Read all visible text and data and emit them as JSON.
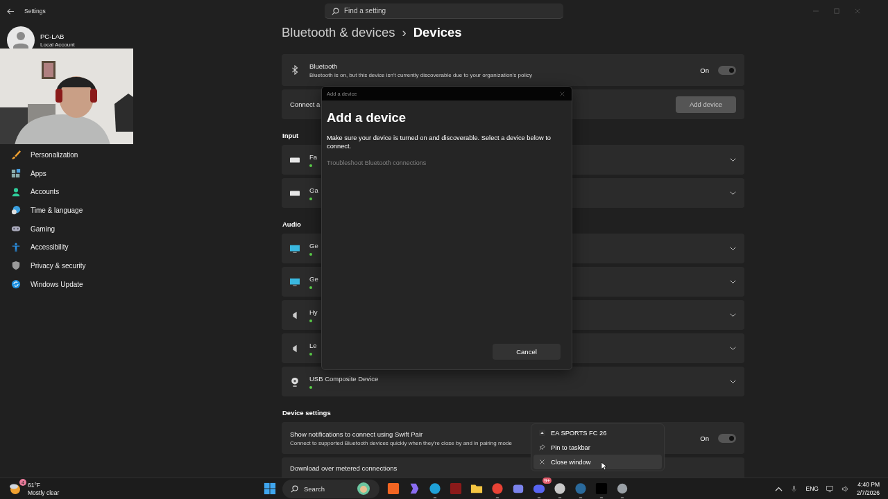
{
  "window": {
    "title": "Settings",
    "search_placeholder": "Find a setting"
  },
  "profile": {
    "name": "PC-LAB",
    "account": "Local Account"
  },
  "sidebar": {
    "items": [
      {
        "label": "Personalization",
        "selected": false
      },
      {
        "label": "Apps",
        "selected": false
      },
      {
        "label": "Accounts",
        "selected": false
      },
      {
        "label": "Time & language",
        "selected": false
      },
      {
        "label": "Gaming",
        "selected": false
      },
      {
        "label": "Accessibility",
        "selected": false
      },
      {
        "label": "Privacy & security",
        "selected": false
      },
      {
        "label": "Windows Update",
        "selected": false
      }
    ]
  },
  "breadcrumb": {
    "parent": "Bluetooth & devices",
    "separator": "›",
    "current": "Devices"
  },
  "bluetooth": {
    "title": "Bluetooth",
    "description": "Bluetooth is on, but this device isn't currently discoverable due to your organization's policy",
    "state_label": "On",
    "on": true
  },
  "connect": {
    "label": "Connect a",
    "button": "Add device"
  },
  "sections": [
    {
      "title": "Input",
      "devices": [
        {
          "name": "Fa",
          "kind": "keyboard",
          "connected": true
        },
        {
          "name": "Ga",
          "kind": "keyboard",
          "connected": true
        }
      ]
    },
    {
      "title": "Audio",
      "devices": [
        {
          "name": "Ge",
          "kind": "monitor",
          "connected": true
        },
        {
          "name": "Ge",
          "kind": "monitor",
          "connected": true
        },
        {
          "name": "Hy",
          "kind": "speaker",
          "connected": true
        },
        {
          "name": "Le",
          "kind": "speaker",
          "connected": true
        },
        {
          "name": "USB Composite Device",
          "kind": "webcam",
          "connected": true
        }
      ]
    }
  ],
  "device_settings": {
    "title": "Device settings",
    "swift_pair": {
      "title": "Show notifications to connect using Swift Pair",
      "description": "Connect to supported Bluetooth devices quickly when they're close by and in pairing mode",
      "state_label": "On",
      "on": true
    },
    "metered": {
      "title": "Download over metered connections"
    }
  },
  "dialog": {
    "title_bar": "Add a device",
    "heading": "Add a device",
    "body": "Make sure your device is turned on and discoverable. Select a device below to connect.",
    "link": "Troubleshoot Bluetooth connections",
    "link_disabled": true,
    "cancel": "Cancel"
  },
  "context_menu": {
    "items": [
      {
        "label": "EA SPORTS FC 26",
        "hovered": false
      },
      {
        "label": "Pin to taskbar",
        "hovered": false
      },
      {
        "label": "Close window",
        "hovered": true
      }
    ]
  },
  "taskbar": {
    "weather": {
      "badge": "4",
      "temperature": "61°F",
      "condition": "Mostly clear"
    },
    "search": "Search",
    "apps": [
      {
        "kind": "tile",
        "color": "#f26522",
        "active": false
      },
      {
        "kind": "copilot",
        "color": "#8a6cf0",
        "active": false
      },
      {
        "kind": "edge",
        "color": "#1fa1d8",
        "active": true
      },
      {
        "kind": "tile",
        "color": "#8b1a1a",
        "active": false
      },
      {
        "kind": "folder",
        "color": "#f4c542",
        "active": false
      },
      {
        "kind": "chrome",
        "color": "#e94235",
        "active": true
      },
      {
        "kind": "teams",
        "color": "#7b83eb",
        "active": false
      },
      {
        "kind": "discord",
        "color": "#5865f2",
        "active": true,
        "badge": "9+"
      },
      {
        "kind": "obs",
        "color": "#c8c8c8",
        "active": true
      },
      {
        "kind": "steam",
        "color": "#2a6a9c",
        "active": true
      },
      {
        "kind": "game",
        "color": "#000000",
        "active": true
      },
      {
        "kind": "gear",
        "color": "#9aa0a6",
        "active": true
      }
    ],
    "language": "ENG",
    "time": "4:40 PM",
    "date": "2/7/2026"
  }
}
